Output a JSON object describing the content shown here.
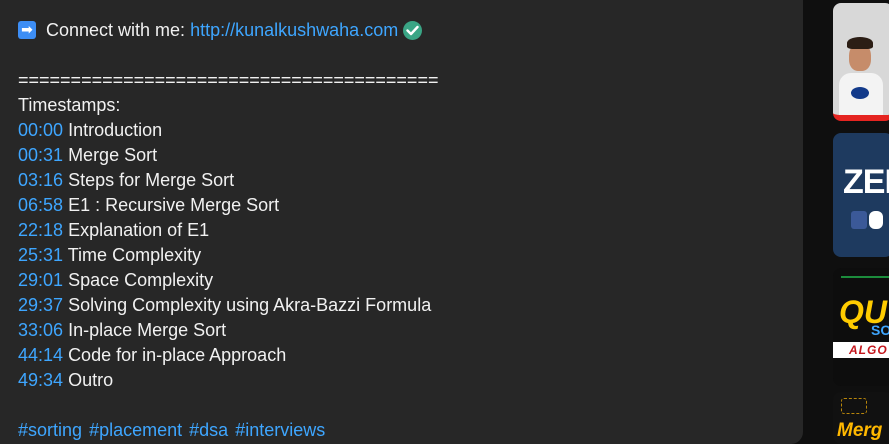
{
  "description": {
    "connect": {
      "arrow_glyph": "➡",
      "label": "Connect with me:",
      "url": "http://kunalkushwaha.com"
    },
    "separator": "========================================",
    "timestamps_heading": "Timestamps:",
    "timestamps": [
      {
        "time": "00:00",
        "title": "Introduction"
      },
      {
        "time": "00:31",
        "title": "Merge Sort"
      },
      {
        "time": "03:16",
        "title": "Steps for Merge Sort"
      },
      {
        "time": "06:58",
        "title": "E1 : Recursive Merge Sort"
      },
      {
        "time": "22:18",
        "title": "Explanation of E1"
      },
      {
        "time": "25:31",
        "title": "Time Complexity"
      },
      {
        "time": "29:01",
        "title": "Space Complexity"
      },
      {
        "time": "29:37",
        "title": "Solving Complexity using Akra-Bazzi Formula"
      },
      {
        "time": "33:06",
        "title": "In-place Merge Sort"
      },
      {
        "time": "44:14",
        "title": "Code for in-place Approach"
      },
      {
        "time": "49:34",
        "title": "Outro"
      }
    ],
    "hashtags": [
      "#sorting",
      "#placement",
      "#dsa",
      "#interviews"
    ]
  },
  "sidebar": {
    "thumbnails": [
      {
        "text": ""
      },
      {
        "text": "ZER"
      },
      {
        "text": "QU",
        "sub": "SO",
        "banner": "ALGO"
      },
      {
        "text": "Merg"
      }
    ]
  },
  "colors": {
    "link": "#3ea6ff",
    "panel": "#272727",
    "background": "#0f0f0f",
    "check": "#3aa585"
  }
}
